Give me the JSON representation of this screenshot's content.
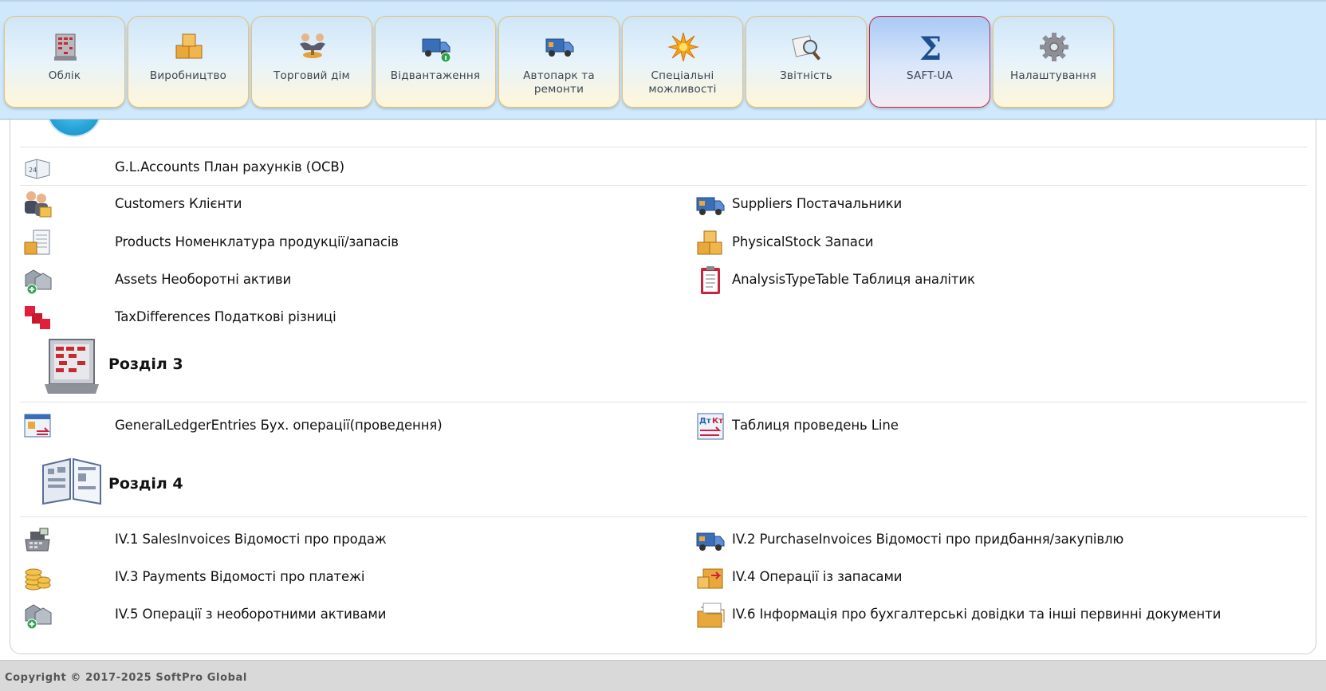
{
  "ribbon": {
    "tiles": [
      {
        "label": "Облік",
        "icon": "abacus-icon"
      },
      {
        "label": "Виробництво",
        "icon": "boxes-icon"
      },
      {
        "label": "Торговий дім",
        "icon": "handshake-icon"
      },
      {
        "label": "Відвантаження",
        "icon": "truck-info-icon"
      },
      {
        "label": "Автопарк та ремонти",
        "icon": "truck-icon"
      },
      {
        "label": "Спеціальні можливості",
        "icon": "star-burst-icon"
      },
      {
        "label": "Звітність",
        "icon": "report-magnifier-icon"
      },
      {
        "label": "SAFT-UA",
        "icon": "sigma-icon",
        "active": true
      },
      {
        "label": "Налаштування",
        "icon": "gear-icon"
      }
    ],
    "accent_active_border": "#c8243f",
    "tile_border": "#e8c27a"
  },
  "items": {
    "gl_accounts": "G.L.Accounts План рахунків (ОСВ)",
    "customers": "Customers Клієнти",
    "suppliers": "Suppliers Постачальники",
    "products": "Products Номенклатура продукції/запасів",
    "physical_stock": "PhysicalStock Запаси",
    "assets": "Assets Необоротні активи",
    "analysis_type": "AnalysisTypeTable Таблиця аналітик",
    "tax_differences": "TaxDifferences Податкові різниці",
    "gl_entries": "GeneralLedgerEntries Бух. операції(проведення)",
    "entries_table": "Таблиця проведень Line",
    "sales_invoices": "IV.1 SalesInvoices Відомості про продаж",
    "purchase_invoices": "IV.2 PurchaseInvoices Відомості про придбання/закупівлю",
    "payments": "IV.3 Payments Відомості про платежі",
    "stock_ops": "IV.4 Операції із запасами",
    "asset_ops": "IV.5 Операції з необоротними активами",
    "docs_info": "IV.6 Інформація про бухгалтерські довідки та інші первинні документи"
  },
  "sections": {
    "s3": "Розділ 3",
    "s4": "Розділ 4"
  },
  "footer": {
    "copyright": "Copyright © 2017-2025 SoftPro Global"
  }
}
